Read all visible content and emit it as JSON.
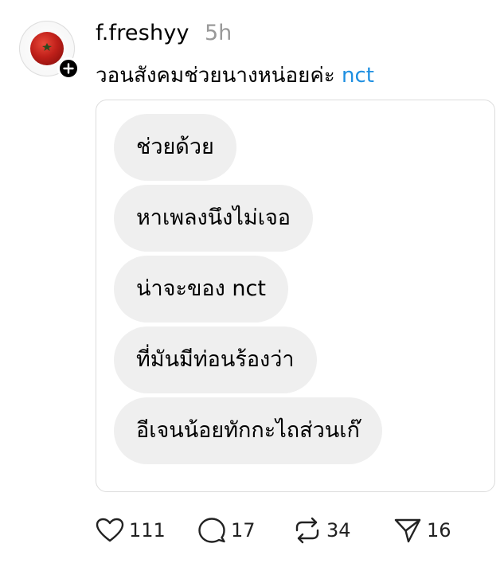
{
  "post": {
    "username": "f.freshyy",
    "time": "5h",
    "caption_text": "วอนสังคมช่วยนางหน่อยค่ะ ",
    "caption_tag": "nct"
  },
  "messages": [
    "ช่วยด้วย",
    "หาเพลงนึงไม่เจอ",
    "น่าจะของ nct",
    "ที่มันมีท่อนร้องว่า",
    "อีเจนน้อยทักกะไถส่วนเก๊"
  ],
  "actions": {
    "likes": "111",
    "comments": "17",
    "reposts": "34",
    "shares": "16"
  },
  "colors": {
    "tag": "#1e8fe1",
    "time": "#999999",
    "bubble": "#efefef"
  },
  "icons": [
    "plus-icon",
    "heart-icon",
    "comment-icon",
    "repost-icon",
    "share-icon"
  ]
}
